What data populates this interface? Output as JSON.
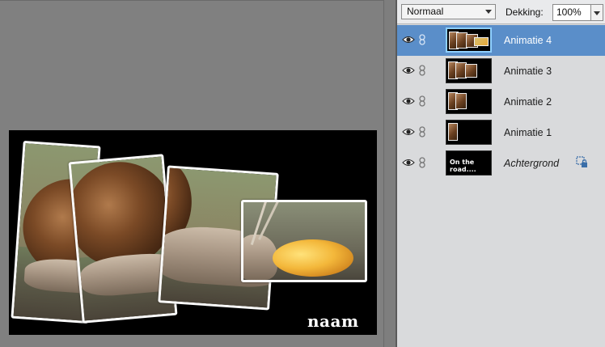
{
  "canvas": {
    "watermark_text": "naam"
  },
  "layers_panel": {
    "blend_mode": "Normaal",
    "opacity_label": "Dekking:",
    "opacity_value": "100%",
    "layers": [
      {
        "name": "Animatie 4",
        "selected": true,
        "italic": false
      },
      {
        "name": "Animatie 3",
        "selected": false,
        "italic": false
      },
      {
        "name": "Animatie 2",
        "selected": false,
        "italic": false
      },
      {
        "name": "Animatie 1",
        "selected": false,
        "italic": false
      },
      {
        "name": "Achtergrond",
        "selected": false,
        "italic": true,
        "thumb_text": "On the road...."
      }
    ]
  },
  "colors": {
    "selected_row": "#5a8ec9",
    "panel_bg": "#d9dadc",
    "canvas_bg": "#808080"
  },
  "icons": {
    "visibility": "eye-icon",
    "link": "chain-link-icon",
    "background_lock": "lock-icon"
  }
}
